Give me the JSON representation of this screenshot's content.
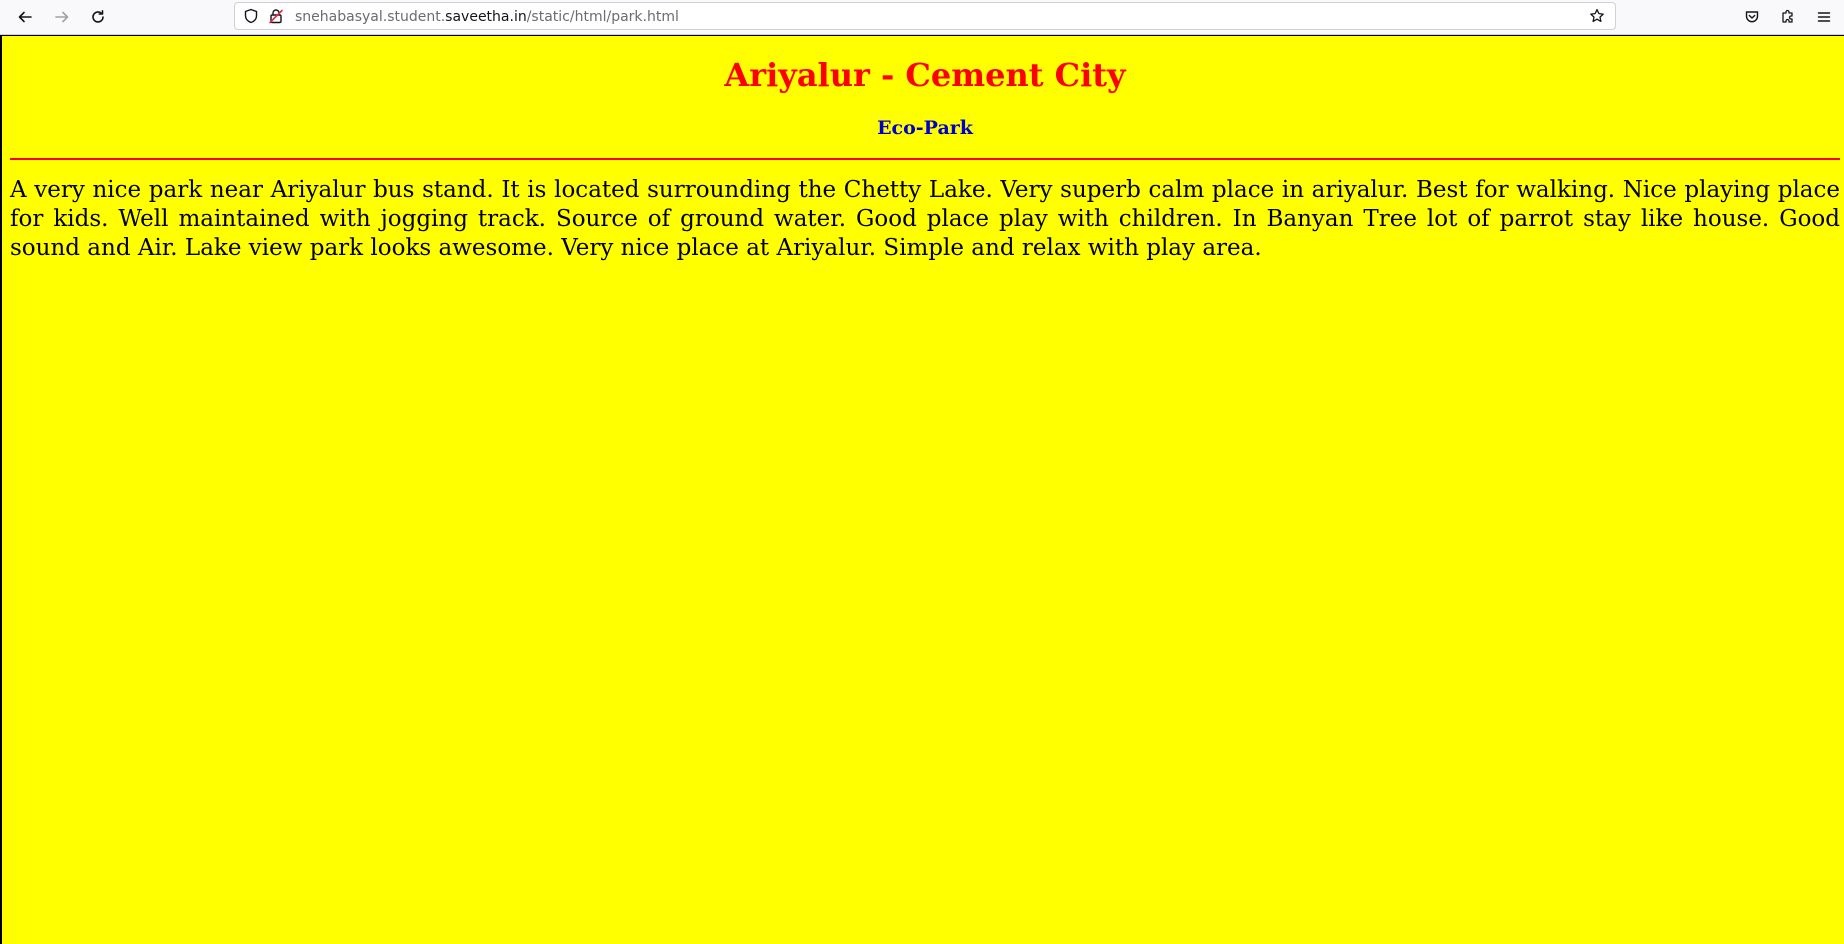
{
  "browser": {
    "url_prefix": "snehabasyal.student.",
    "url_host": "saveetha.in",
    "url_path": "/static/html/park.html"
  },
  "page": {
    "title": "Ariyalur - Cement City",
    "subtitle": "Eco-Park",
    "description": "A very nice park near Ariyalur bus stand. It is located surrounding the Chetty Lake. Very superb calm place in ariyalur. Best for walking. Nice playing place for kids. Well maintained with jogging track. Source of ground water. Good place play with children. In Banyan Tree lot of parrot stay like house. Good sound and Air. Lake view park looks awesome. Very nice place at Ariyalur. Simple and relax with play area."
  },
  "colors": {
    "background": "#ffff00",
    "title": "#ff0000",
    "subtitle": "#0000cc",
    "divider": "#ff0000"
  }
}
